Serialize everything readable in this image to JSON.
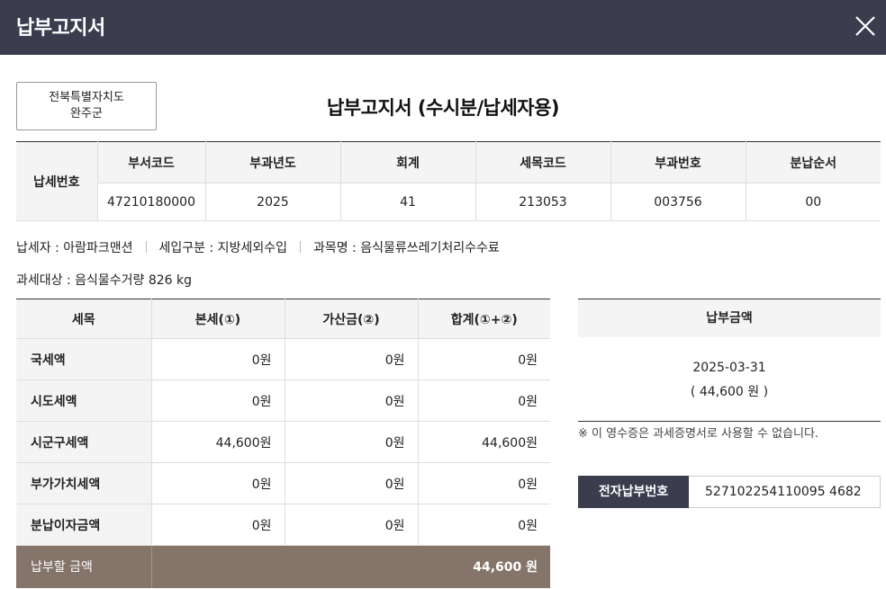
{
  "header": {
    "title": "납부고지서"
  },
  "org": {
    "line1": "전북특별자치도",
    "line2": "완주군"
  },
  "document": {
    "title": "납부고지서 (수시분/납세자용)"
  },
  "tax_number": {
    "row_label": "납세번호",
    "columns": [
      "부서코드",
      "부과년도",
      "회계",
      "세목코드",
      "부과번호",
      "분납순서"
    ],
    "values": [
      "47210180000",
      "2025",
      "41",
      "213053",
      "003756",
      "00"
    ]
  },
  "info": {
    "taxpayer": "납세자 : 아람파크맨션",
    "revenue_type": "세입구분 : 지방세외수입",
    "subject": "과목명 : 음식물류쓰레기처리수수료",
    "target": "과세대상 : 음식물수거량 826 kg"
  },
  "tax_table": {
    "headers": [
      "세목",
      "본세(①)",
      "가산금(②)",
      "합계(①+②)"
    ],
    "rows": [
      {
        "label": "국세액",
        "base": "0원",
        "penalty": "0원",
        "total": "0원"
      },
      {
        "label": "시도세액",
        "base": "0원",
        "penalty": "0원",
        "total": "0원"
      },
      {
        "label": "시군구세액",
        "base": "44,600원",
        "penalty": "0원",
        "total": "44,600원"
      },
      {
        "label": "부가가치세액",
        "base": "0원",
        "penalty": "0원",
        "total": "0원"
      },
      {
        "label": "분납이자금액",
        "base": "0원",
        "penalty": "0원",
        "total": "0원"
      }
    ],
    "total_label": "납부할 금액",
    "total_value": "44,600 원"
  },
  "payment": {
    "head": "납부금액",
    "date": "2025-03-31",
    "amount": "( 44,600 원 )"
  },
  "notice": "※ 이 영수증은 과세증명서로 사용할 수 없습니다.",
  "e_payment": {
    "label": "전자납부번호",
    "value": "527102254110095 4682"
  },
  "colors": {
    "header_bg": "#3b3d4f",
    "total_row_bg": "#85746a"
  }
}
